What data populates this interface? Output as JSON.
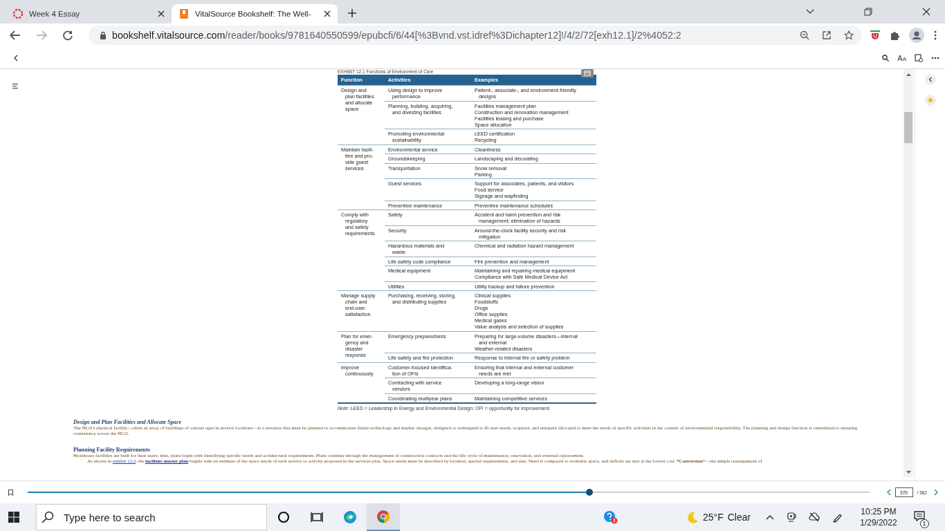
{
  "browser": {
    "tabs": [
      {
        "title": "Week 4 Essay",
        "selected": false
      },
      {
        "title": "VitalSource Bookshelf: The Well-",
        "selected": true
      }
    ],
    "url_domain": "bookshelf.vitalsource.com",
    "url_path": "/reader/books/9781640550599/epubcfi/6/44[%3Bvnd.vst.idref%3Dichapter12]!/4/2/72[exh12.1]/2%4052:2"
  },
  "reader": {
    "font_button": "AA",
    "exhibit_caption": "EXHIBIT 12.1 Functions of Environment of Care",
    "table": {
      "columns": [
        "Function",
        "Activities",
        "Examples"
      ],
      "groups": [
        {
          "function": "Design and\nplan facilities\nand allocate\nspace",
          "rows": [
            {
              "activity": "Using design to improve\nperformance",
              "examples": [
                "Patient-, associate-, and environment-friendly\ndesigns"
              ]
            },
            {
              "activity": "Planning, building, acquiring,\nand divesting facilities",
              "examples": [
                "Facilities management plan",
                "Construction and renovation management",
                "Facilities leasing and purchase",
                "Space allocation"
              ]
            },
            {
              "activity": "Promoting environmental\nsustainability",
              "examples": [
                "LEED certification",
                "Recycling"
              ]
            }
          ]
        },
        {
          "function": "Maintain facili-\nties and pro-\nvide guest\nservices",
          "rows": [
            {
              "activity": "Environmental service",
              "examples": [
                "Cleanliness"
              ]
            },
            {
              "activity": "Groundskeeping",
              "examples": [
                "Landscaping and decorating"
              ]
            },
            {
              "activity": "Transportation",
              "examples": [
                "Snow removal",
                "Parking"
              ]
            },
            {
              "activity": "Guest services",
              "examples": [
                "Support for associates, patients, and visitors",
                "Food service",
                "Signage and wayfinding"
              ]
            },
            {
              "activity": "Preventive maintenance",
              "examples": [
                "Preventive maintenance schedules"
              ]
            }
          ]
        },
        {
          "function": "Comply with\nregulatory\nand safety\nrequirements",
          "rows": [
            {
              "activity": "Safety",
              "examples": [
                "Accident and harm prevention and risk\nmanagement; elimination of hazards"
              ]
            },
            {
              "activity": "Security",
              "examples": [
                "Around-the-clock facility security and risk\nmitigation"
              ]
            },
            {
              "activity": "Hazardous materials and\nwaste",
              "examples": [
                "Chemical and radiation hazard management"
              ]
            },
            {
              "activity": "Life-safety code compliance",
              "examples": [
                "Fire prevention and management"
              ]
            },
            {
              "activity": "Medical equipment",
              "examples": [
                "Maintaining and repairing medical equipment",
                "Compliance with Safe Medical Device Act"
              ]
            },
            {
              "activity": "Utilities",
              "examples": [
                "Utility backup and failure prevention"
              ]
            }
          ]
        },
        {
          "function": "Manage supply\nchain and\nend-user\nsatisfaction",
          "rows": [
            {
              "activity": "Purchasing, receiving, storing,\nand distributing supplies",
              "examples": [
                "Clinical supplies",
                "Foodstuffs",
                "Drugs",
                "Office supplies",
                "Medical gases",
                "Value analysis and selection of supplies"
              ]
            }
          ]
        },
        {
          "function": "Plan for emer-\ngency and\ndisaster\nresponse",
          "rows": [
            {
              "activity": "Emergency preparedness",
              "examples": [
                "Preparing for large-volume disasters—internal\nand external",
                "Weather-related disasters"
              ]
            },
            {
              "activity": "Life-safety and fire protection",
              "examples": [
                "Response to internal fire or safety problem"
              ]
            }
          ]
        },
        {
          "function": "Improve\ncontinuously",
          "rows": [
            {
              "activity": "Customer-focused identifica-\ntion of OFIs",
              "examples": [
                "Ensuring that internal and external customer\nneeds are met"
              ]
            },
            {
              "activity": "Contracting with service\nvendors",
              "examples": [
                "Developing a long-range vision"
              ]
            },
            {
              "activity": "Coordinating multiyear plans",
              "examples": [
                "Maintaining competitive services"
              ]
            }
          ]
        }
      ]
    },
    "note": "*Note:* LEED = Leadership in Energy and Environmental Design; OFI = opportunity for improvement.",
    "sections": [
      {
        "heading": "Design and Plan Facilities and Allocate Space",
        "kind": "italic",
        "paragraphs": [
          [
            {
              "text": "The HCO's physical facility—often an array of buildings of various ages in several locations—is a resource that must be planned to accommodate future technology and market changes, designed or redesigned to fit user needs, acquired, and uniquely allocated to meet the needs of specific activities in the context of environmental responsibility. The planning and design function is centralized to ensuring consistency across the HCO."
            }
          ]
        ]
      },
      {
        "heading": "Planning Facility Requirements",
        "kind": "plain",
        "paragraphs": [
          [
            {
              "text": "Healthcare facilities are built for their users; thus, plans begin with identifying specific needs and architectural requirements. Plans continue through the management of construction contracts and the life cycle of maintenance, renovation, and eventual replacement."
            }
          ],
          [
            {
              "text": "As shown in "
            },
            {
              "text": "exhibit 12.2",
              "kind": "link"
            },
            {
              "text": ", the "
            },
            {
              "text": "facilities master plan",
              "kind": "term"
            },
            {
              "text": " begins with an estimate of the space needs of each service or activity proposed in the services plan. Space needs must be described by location, special requirements, and size. Need is compared to available space, and deficits are met at the lowest cost. ***Conversion***—the simple reassignment of"
            }
          ]
        ]
      }
    ]
  },
  "footer": {
    "progress": {
      "level": 0.667
    },
    "page": "370",
    "total": "/ 562"
  },
  "taskbar": {
    "search_placeholder": "Type here to search",
    "apps": [
      {
        "kind": "cortana",
        "selected": false
      },
      {
        "kind": "task-view",
        "selected": false
      },
      {
        "kind": "edge",
        "selected": false
      },
      {
        "kind": "chrome",
        "selected": true
      }
    ],
    "weather": {
      "temperature": "25°F",
      "condition": "Clear"
    },
    "time": "10:25 PM",
    "date": "1/29/2022",
    "notifications": "1"
  }
}
